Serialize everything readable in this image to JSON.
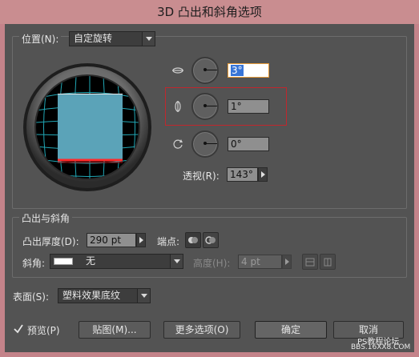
{
  "window": {
    "title": "3D 凸出和斜角选项"
  },
  "position": {
    "label": "位置(N):",
    "preset": "自定旋转",
    "rotate_x": {
      "value": "3°",
      "prefix": "",
      "selected": "3°"
    },
    "rotate_y": {
      "value": "1°"
    },
    "rotate_z": {
      "value": "0°"
    },
    "perspective": {
      "label": "透视(R):",
      "value": "143°"
    }
  },
  "extrude": {
    "section_label": "凸出与斜角",
    "depth_label": "凸出厚度(D):",
    "depth_value": "290 pt",
    "cap_label": "端点:",
    "bevel_label": "斜角:",
    "bevel_value": "无",
    "height_label": "高度(H):",
    "height_value": "4 pt"
  },
  "surface": {
    "label": "表面(S):",
    "value": "塑料效果底纹"
  },
  "footer": {
    "preview_label": "预览(P)",
    "preview_checked": true,
    "map_button": "贴图(M)...",
    "more_button": "更多选项(O)",
    "ok_button": "确定",
    "cancel_button": "取消"
  },
  "watermark": {
    "line1": "PS教程论坛",
    "line2": "BBS.16XX8.COM"
  },
  "colors": {
    "panel": "#535353",
    "highlight_box": "#c0272d",
    "cube_face": "#5ba3b8",
    "grid": "#21a7b5"
  }
}
